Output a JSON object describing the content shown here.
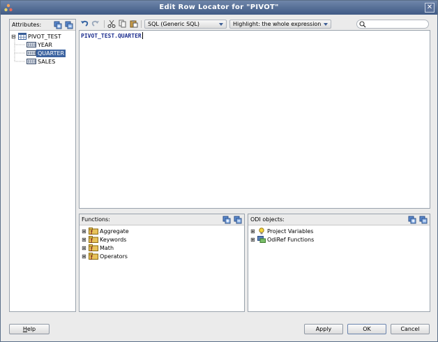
{
  "window": {
    "title": "Edit Row Locator for \"PIVOT\"",
    "close_glyph": "✕"
  },
  "attributes": {
    "label": "Attributes:",
    "tree": [
      {
        "label": "PIVOT_TEST",
        "expander": "⊟",
        "icon": "table-icon"
      },
      {
        "label": "YEAR",
        "icon": "column-icon"
      },
      {
        "label": "QUARTER",
        "icon": "column-icon",
        "selected": true
      },
      {
        "label": "SALES",
        "icon": "column-icon"
      }
    ]
  },
  "toolbar": {
    "dialect": "SQL (Generic SQL)",
    "highlight": "Highlight: the whole expression",
    "search_placeholder": ""
  },
  "editor": {
    "text": "PIVOT_TEST.QUARTER"
  },
  "functions": {
    "label": "Functions:",
    "items": [
      {
        "label": "Aggregate"
      },
      {
        "label": "Keywords"
      },
      {
        "label": "Math"
      },
      {
        "label": "Operators"
      }
    ]
  },
  "odi": {
    "label": "ODI objects:",
    "items": [
      {
        "label": "Project Variables",
        "icon": "bulb-icon"
      },
      {
        "label": "OdiRef Functions",
        "icon": "odiref-icon"
      }
    ]
  },
  "buttons": {
    "help_mnemonic": "H",
    "help_rest": "elp",
    "apply": "Apply",
    "ok": "OK",
    "cancel": "Cancel"
  },
  "colors": {
    "selection": "#3c63a0",
    "code": "#1c2e8f",
    "title_bar": "#4f6a94"
  }
}
